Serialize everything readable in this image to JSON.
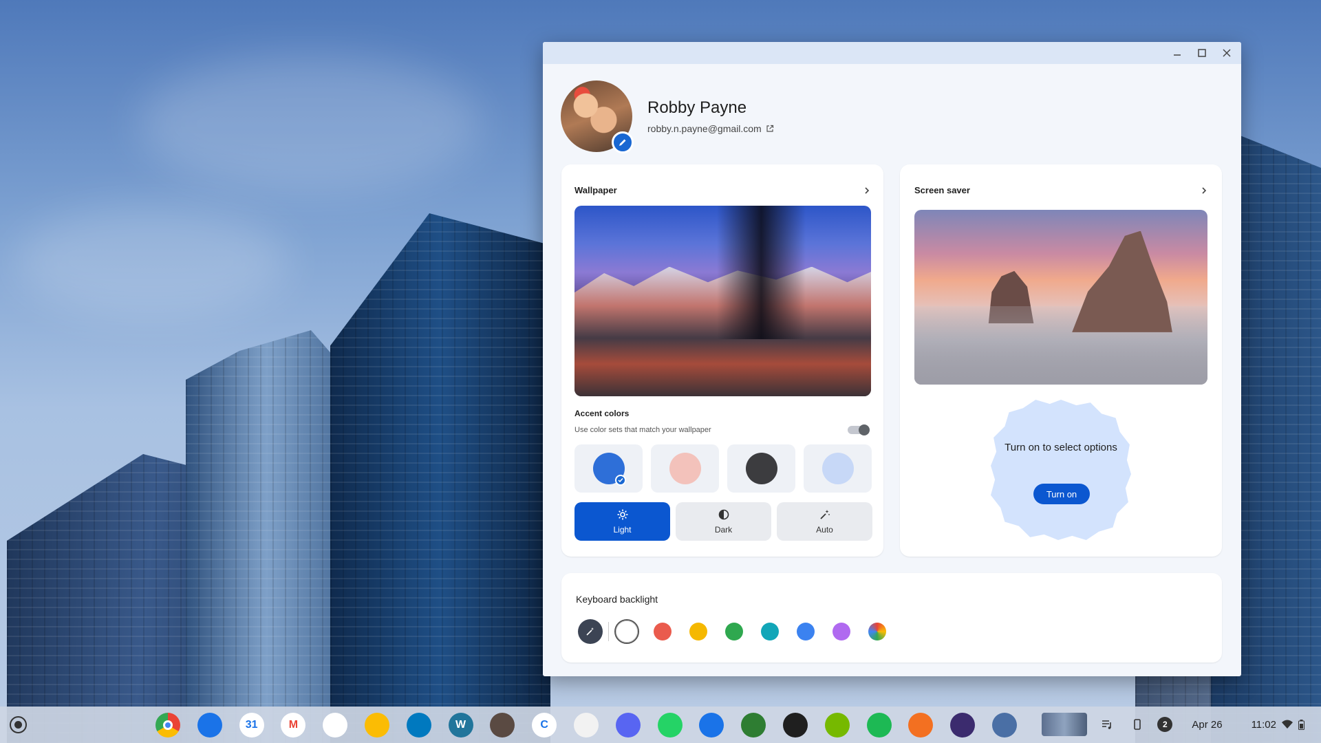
{
  "window": {
    "minimize_icon": "minimize-icon",
    "maximize_icon": "maximize-icon",
    "close_icon": "close-icon"
  },
  "profile": {
    "name": "Robby Payne",
    "email": "robby.n.payne@gmail.com",
    "edit_icon": "pencil-icon",
    "external_icon": "external-link-icon"
  },
  "wallpaper": {
    "title": "Wallpaper",
    "accent_title": "Accent colors",
    "accent_subtitle": "Use color sets that match your wallpaper",
    "accent_swatches": [
      {
        "color": "#2e6fd8",
        "selected": true
      },
      {
        "color": "#f3c2bb",
        "selected": false
      },
      {
        "color": "#3c3c3f",
        "selected": false
      },
      {
        "color": "#c7d8f7",
        "selected": false
      }
    ],
    "modes": [
      {
        "label": "Light",
        "icon": "sun-icon",
        "active": true
      },
      {
        "label": "Dark",
        "icon": "contrast-icon",
        "active": false
      },
      {
        "label": "Auto",
        "icon": "magic-wand-icon",
        "active": false
      }
    ]
  },
  "screensaver": {
    "title": "Screen saver",
    "prompt": "Turn on to select options",
    "button_label": "Turn on"
  },
  "keyboard": {
    "title": "Keyboard backlight",
    "colors": [
      "#ffffff",
      "#ea5b4d",
      "#f5b800",
      "#2fa84f",
      "#12a6b8",
      "#3b82f0",
      "#b06af0",
      "rainbow"
    ]
  },
  "shelf": {
    "apps": [
      {
        "name": "Chrome",
        "color": "#ffffff"
      },
      {
        "name": "Files",
        "color": "#1a73e8"
      },
      {
        "name": "Calendar",
        "color": "#ffffff",
        "text": "31"
      },
      {
        "name": "Gmail",
        "color": "#ffffff",
        "text": "M"
      },
      {
        "name": "Analytics",
        "color": "#ffffff"
      },
      {
        "name": "Keep",
        "color": "#fbbc04"
      },
      {
        "name": "Trello",
        "color": "#0079bf"
      },
      {
        "name": "WordPress",
        "color": "#21759b",
        "text": "W"
      },
      {
        "name": "Brave-like",
        "color": "#5a4a42"
      },
      {
        "name": "Canva",
        "color": "#ffffff",
        "text": "C"
      },
      {
        "name": "Pinwheel",
        "color": "#f2f2f2"
      },
      {
        "name": "Discord",
        "color": "#5865f2"
      },
      {
        "name": "WhatsApp",
        "color": "#25d366"
      },
      {
        "name": "Messages",
        "color": "#1a73e8"
      },
      {
        "name": "Terminal",
        "color": "#2e7d32"
      },
      {
        "name": "Sheets",
        "color": "#1f1f1f"
      },
      {
        "name": "NVIDIA",
        "color": "#76b900"
      },
      {
        "name": "Spotify",
        "color": "#1db954"
      },
      {
        "name": "Arch",
        "color": "#f37021"
      },
      {
        "name": "Camera",
        "color": "#3b2b6e"
      },
      {
        "name": "Personalize",
        "color": "#4a6fa5"
      }
    ],
    "notification_count": "2",
    "date": "Apr 26",
    "time": "11:02"
  }
}
